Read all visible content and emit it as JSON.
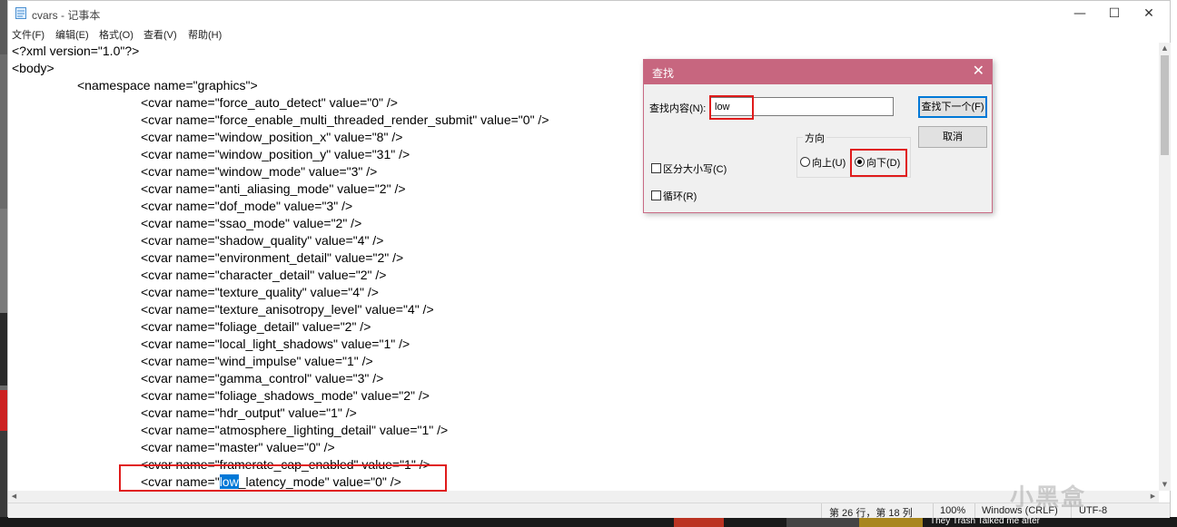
{
  "window": {
    "title": "cvars - 记事本",
    "minimize": "—",
    "maximize": "☐",
    "close": "✕"
  },
  "menu": [
    "文件(F)",
    "编辑(E)",
    "格式(O)",
    "查看(V)",
    "帮助(H)"
  ],
  "editor": {
    "lines": [
      {
        "indent": 0,
        "text": "<?xml version=\"1.0\"?>"
      },
      {
        "indent": 0,
        "text": "<body>"
      },
      {
        "indent": 1,
        "text": "<namespace name=\"graphics\">"
      },
      {
        "indent": 2,
        "text": "<cvar name=\"force_auto_detect\" value=\"0\" />"
      },
      {
        "indent": 2,
        "text": "<cvar name=\"force_enable_multi_threaded_render_submit\" value=\"0\" />"
      },
      {
        "indent": 2,
        "text": "<cvar name=\"window_position_x\" value=\"8\" />"
      },
      {
        "indent": 2,
        "text": "<cvar name=\"window_position_y\" value=\"31\" />"
      },
      {
        "indent": 2,
        "text": "<cvar name=\"window_mode\" value=\"3\" />"
      },
      {
        "indent": 2,
        "text": "<cvar name=\"anti_aliasing_mode\" value=\"2\" />"
      },
      {
        "indent": 2,
        "text": "<cvar name=\"dof_mode\" value=\"3\" />"
      },
      {
        "indent": 2,
        "text": "<cvar name=\"ssao_mode\" value=\"2\" />"
      },
      {
        "indent": 2,
        "text": "<cvar name=\"shadow_quality\" value=\"4\" />"
      },
      {
        "indent": 2,
        "text": "<cvar name=\"environment_detail\" value=\"2\" />"
      },
      {
        "indent": 2,
        "text": "<cvar name=\"character_detail\" value=\"2\" />"
      },
      {
        "indent": 2,
        "text": "<cvar name=\"texture_quality\" value=\"4\" />"
      },
      {
        "indent": 2,
        "text": "<cvar name=\"texture_anisotropy_level\" value=\"4\" />"
      },
      {
        "indent": 2,
        "text": "<cvar name=\"foliage_detail\" value=\"2\" />"
      },
      {
        "indent": 2,
        "text": "<cvar name=\"local_light_shadows\" value=\"1\" />"
      },
      {
        "indent": 2,
        "text": "<cvar name=\"wind_impulse\" value=\"1\" />"
      },
      {
        "indent": 2,
        "text": "<cvar name=\"gamma_control\" value=\"3\" />"
      },
      {
        "indent": 2,
        "text": "<cvar name=\"foliage_shadows_mode\" value=\"2\" />"
      },
      {
        "indent": 2,
        "text": "<cvar name=\"hdr_output\" value=\"1\" />"
      },
      {
        "indent": 2,
        "text": "<cvar name=\"atmosphere_lighting_detail\" value=\"1\" />"
      },
      {
        "indent": 2,
        "text": "<cvar name=\"master\" value=\"0\" />"
      },
      {
        "indent": 2,
        "text": "<cvar name=\"framerate_cap_enabled\" value=\"1\" />"
      }
    ],
    "selected_line": {
      "before": "<cvar name=\"",
      "selected": "low",
      "after": "_latency_mode\" value=\"0\" />"
    }
  },
  "status": {
    "position": "第 26 行，第 18 列",
    "zoom": "100%",
    "line_ending": "Windows (CRLF)",
    "encoding": "UTF-8"
  },
  "find_dialog": {
    "title": "查找",
    "find_label": "查找内容(N):",
    "find_value": "low",
    "find_next": "查找下一个(F)",
    "cancel": "取消",
    "direction_label": "方向",
    "up": "向上(U)",
    "down": "向下(D)",
    "match_case": "区分大小写(C)",
    "wrap": "循环(R)",
    "close": "✕"
  },
  "watermark": "小黑盒",
  "background_caption": "They Trash Talked me after",
  "colors": {
    "dialog_title": "#c7667f",
    "selection": "#0078d7",
    "highlight_box": "#e01b1b"
  }
}
